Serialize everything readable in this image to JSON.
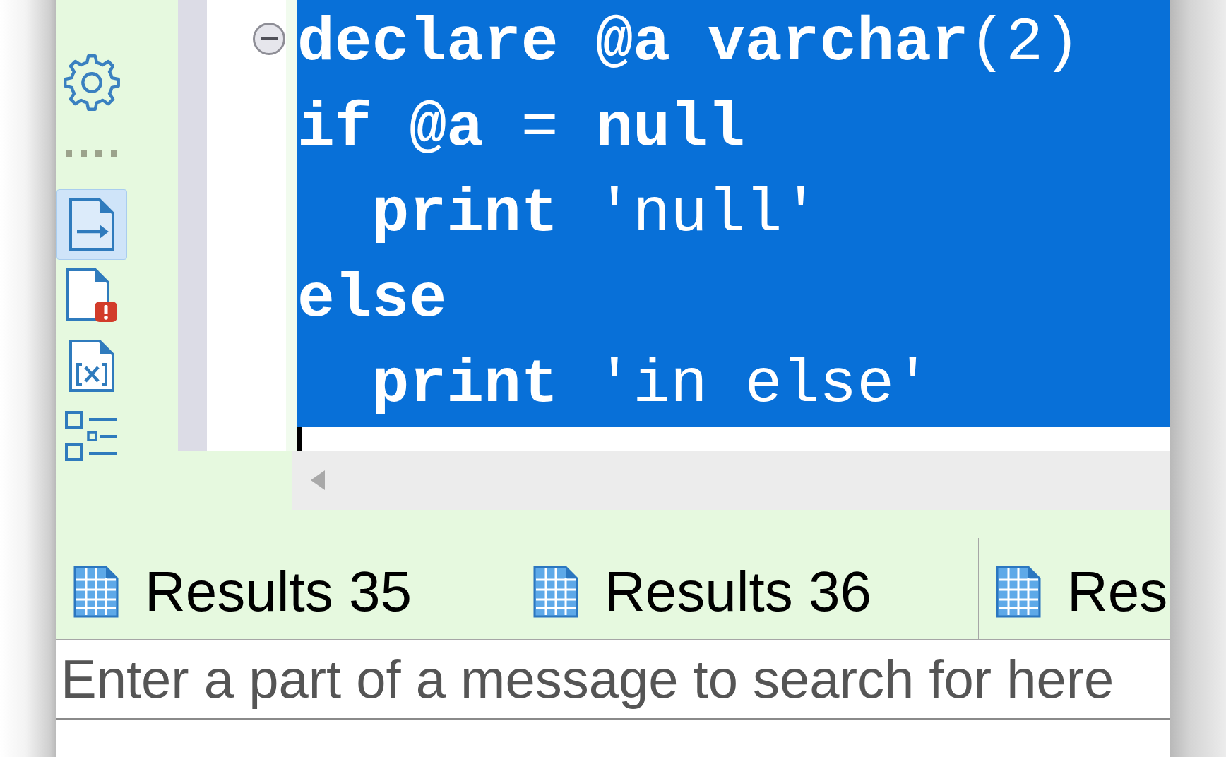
{
  "side_toolbar": {
    "groups": [
      {
        "buttons": [
          {
            "kind": "settings",
            "selected": false
          }
        ]
      },
      {
        "buttons": [
          {
            "kind": "output",
            "selected": true
          },
          {
            "kind": "problems",
            "selected": false
          },
          {
            "kind": "variables",
            "selected": false
          },
          {
            "kind": "outline",
            "selected": false
          }
        ]
      }
    ]
  },
  "editor": {
    "fold": {
      "expanded": true
    },
    "lines": [
      {
        "selected": true,
        "segments": [
          {
            "text": "declare @a varchar",
            "kind": "keyword"
          },
          {
            "text": "(2)",
            "kind": "plain"
          }
        ]
      },
      {
        "selected": true,
        "segments": [
          {
            "text": "if @a",
            "kind": "keyword"
          },
          {
            "text": " = ",
            "kind": "plain"
          },
          {
            "text": "null",
            "kind": "keyword"
          }
        ]
      },
      {
        "selected": true,
        "segments": [
          {
            "text": "  print",
            "kind": "keyword"
          },
          {
            "text": " 'null'",
            "kind": "plain"
          }
        ]
      },
      {
        "selected": true,
        "segments": [
          {
            "text": "else",
            "kind": "keyword"
          }
        ]
      },
      {
        "selected": true,
        "segments": [
          {
            "text": "  print",
            "kind": "keyword"
          },
          {
            "text": " 'in else'",
            "kind": "plain"
          }
        ]
      }
    ]
  },
  "result_tabs": [
    {
      "label": "Results 35",
      "selected": false
    },
    {
      "label": "Results 36",
      "selected": false
    },
    {
      "label": "Res",
      "selected": false
    }
  ],
  "message_search": {
    "placeholder": "Enter a part of a message to search for here"
  }
}
